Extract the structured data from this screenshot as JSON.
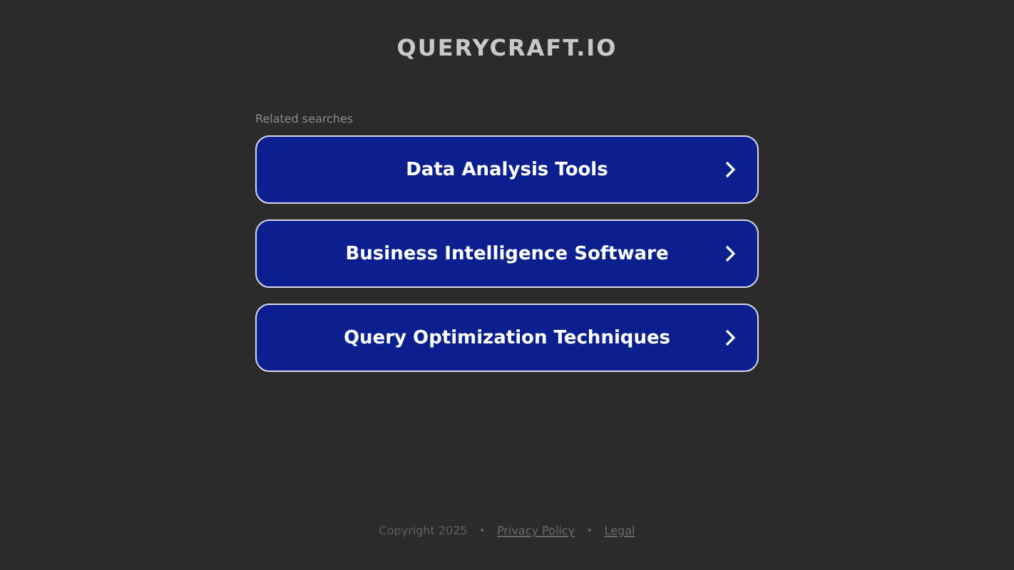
{
  "site_title": "QUERYCRAFT.IO",
  "related_label": "Related searches",
  "links": [
    {
      "label": "Data Analysis Tools"
    },
    {
      "label": "Business Intelligence Software"
    },
    {
      "label": "Query Optimization Techniques"
    }
  ],
  "footer": {
    "copyright": "Copyright 2025",
    "separators": [
      "•",
      "•"
    ],
    "links": [
      "Privacy Policy",
      "Legal"
    ]
  }
}
